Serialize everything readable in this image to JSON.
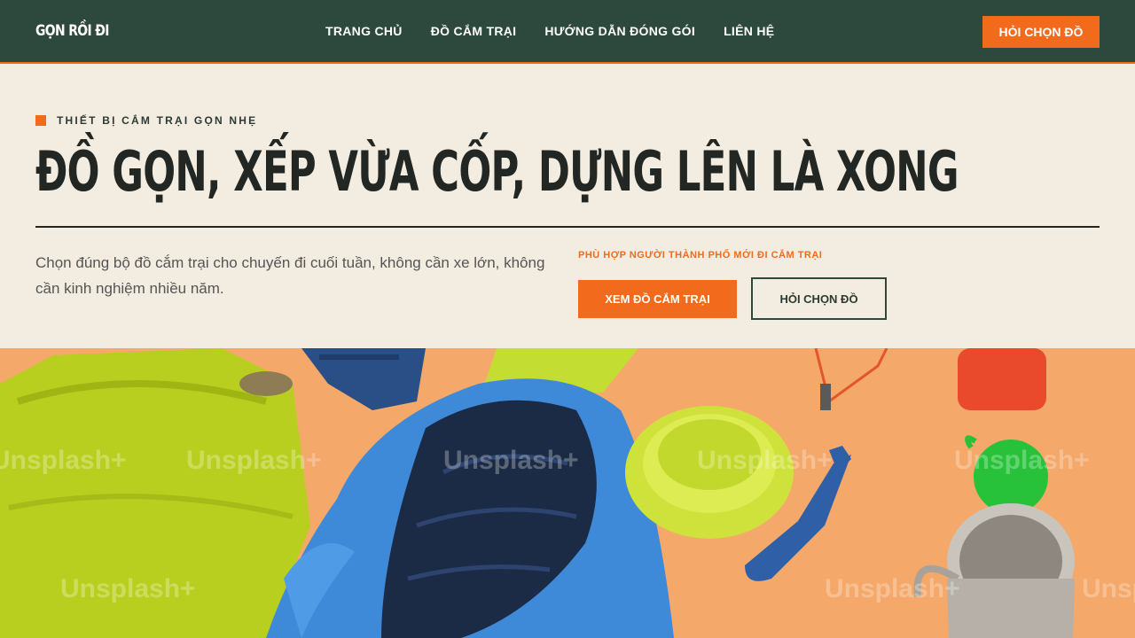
{
  "brand": {
    "logo": "GỌN RỒI ĐI"
  },
  "nav": {
    "items": [
      {
        "label": "TRANG CHỦ"
      },
      {
        "label": "ĐỒ CẮM TRẠI"
      },
      {
        "label": "HƯỚNG DẪN ĐÓNG GÓI"
      },
      {
        "label": "LIÊN HỆ"
      }
    ],
    "cta": "HỎI CHỌN ĐỒ"
  },
  "hero": {
    "eyebrow": "THIẾT BỊ CẮM TRẠI GỌN NHẸ",
    "title": "ĐỒ GỌN, XẾP VỪA CỐP, DỰNG LÊN LÀ XONG",
    "lead": "Chọn đúng bộ đồ cắm trại cho chuyến đi cuối tuần, không cần xe lớn, không cần kinh nghiệm nhiều năm.",
    "fit_note": "PHÙ HỢP NGƯỜI THÀNH PHỐ MỚI ĐI CẮM TRẠI",
    "primary_button": "XEM ĐỒ CẮM TRẠI",
    "secondary_button": "HỎI CHỌN ĐỒ"
  },
  "photo": {
    "watermark": "Unsplash+"
  },
  "colors": {
    "nav_bg": "#2d483c",
    "accent": "#f26a1b",
    "hero_bg": "#f3ece0",
    "photo_bg": "#f4a86a"
  }
}
